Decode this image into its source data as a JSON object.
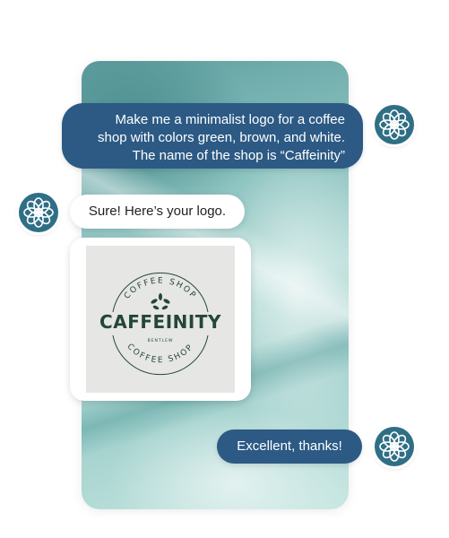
{
  "conversation": {
    "user_message_1": {
      "lines": [
        "Make me a minimalist logo for a coffee",
        "shop with colors green, brown, and white.",
        "The name of the shop is “Caffeinity”"
      ]
    },
    "assistant_message_1": {
      "text": "Sure! Here’s your logo."
    },
    "generated_logo": {
      "arc_top": "COFFEE SHOP",
      "brand_name": "CAFFEINITY",
      "small_text": "BENTLEW",
      "arc_bottom": "COFFEE SHOP"
    },
    "user_message_2": {
      "text": "Excellent, thanks!"
    }
  },
  "avatars": {
    "user_icon": "flower-knot-icon",
    "assistant_icon": "flower-knot-icon"
  },
  "colors": {
    "user_bubble": "#2c5a84",
    "avatar_fill": "#2f6f86",
    "logo_green": "#23463a"
  }
}
